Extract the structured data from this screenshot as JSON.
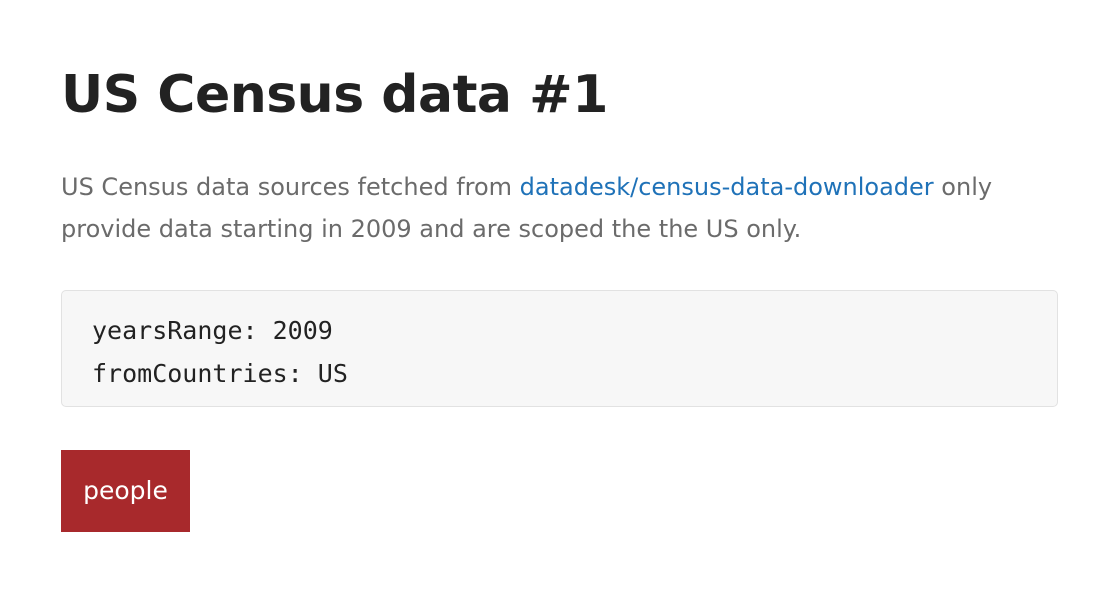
{
  "page": {
    "title": "US Census data #1",
    "description": {
      "before_link": "US Census data sources fetched from ",
      "link_text": "datadesk/census-data-downloader",
      "after_link": " only provide data starting in 2009 and are scoped the the US only."
    },
    "config": {
      "lines": [
        "yearsRange: 2009",
        "fromCountries: US"
      ]
    },
    "tag_button_label": "people"
  },
  "colors": {
    "link": "#1f72b8",
    "button_bg": "#a8292c",
    "text": "#222222",
    "muted_text": "#6b6b6b"
  }
}
